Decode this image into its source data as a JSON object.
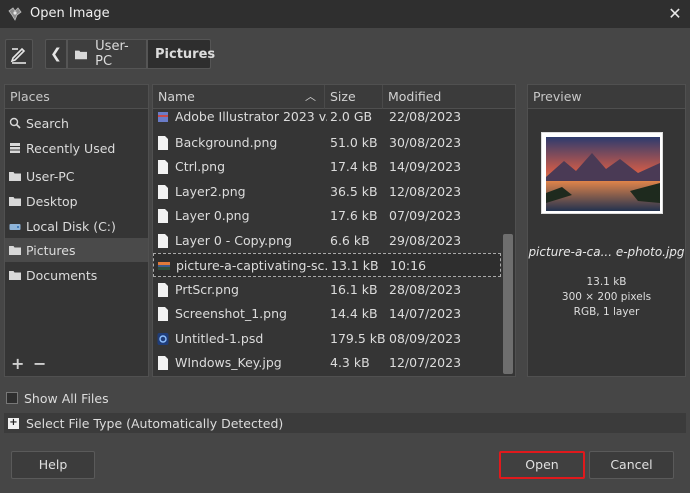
{
  "window": {
    "title": "Open Image"
  },
  "nav": {
    "back_icon": "chevron-left-icon",
    "breadcrumbs": [
      "User-PC",
      "Pictures"
    ]
  },
  "places": {
    "header": "Places",
    "items": [
      {
        "label": "Search",
        "icon": "search-icon"
      },
      {
        "label": "Recently Used",
        "icon": "recent-icon"
      },
      {
        "label": "User-PC",
        "icon": "folder-icon"
      },
      {
        "label": "Desktop",
        "icon": "folder-icon"
      },
      {
        "label": "Local Disk (C:)",
        "icon": "drive-icon"
      },
      {
        "label": "Pictures",
        "icon": "folder-icon",
        "selected": true
      },
      {
        "label": "Documents",
        "icon": "folder-icon"
      }
    ],
    "add_label": "+",
    "remove_label": "−"
  },
  "files": {
    "columns": {
      "name": "Name",
      "size": "Size",
      "modified": "Modified"
    },
    "rows": [
      {
        "name": "Adobe Illustrator 2023 v...",
        "size": "2.0 GB",
        "modified": "22/08/2023",
        "icon": "archive-icon"
      },
      {
        "name": "Background.png",
        "size": "51.0 kB",
        "modified": "30/08/2023",
        "icon": "file-icon"
      },
      {
        "name": "Ctrl.png",
        "size": "17.4 kB",
        "modified": "14/09/2023",
        "icon": "file-icon"
      },
      {
        "name": "Layer2.png",
        "size": "36.5 kB",
        "modified": "12/08/2023",
        "icon": "file-icon"
      },
      {
        "name": "Layer 0.png",
        "size": "17.6 kB",
        "modified": "07/09/2023",
        "icon": "file-icon"
      },
      {
        "name": "Layer 0 - Copy.png",
        "size": "6.6 kB",
        "modified": "29/08/2023",
        "icon": "file-icon"
      },
      {
        "name": "picture-a-captivating-sc...",
        "size": "13.1 kB",
        "modified": "10:16",
        "icon": "image-thumb-icon",
        "selected": true
      },
      {
        "name": "PrtScr.png",
        "size": "16.1 kB",
        "modified": "28/08/2023",
        "icon": "file-icon"
      },
      {
        "name": "Screenshot_1.png",
        "size": "14.4 kB",
        "modified": "14/07/2023",
        "icon": "file-icon"
      },
      {
        "name": "Untitled-1.psd",
        "size": "179.5 kB",
        "modified": "08/09/2023",
        "icon": "psd-icon"
      },
      {
        "name": "WIndows_Key.jpg",
        "size": "4.3 kB",
        "modified": "12/07/2023",
        "icon": "file-icon"
      }
    ]
  },
  "preview": {
    "header": "Preview",
    "filename": "picture-a-ca... e-photo.jpg",
    "size": "13.1 kB",
    "dimensions": "300 × 200 pixels",
    "mode": "RGB, 1 layer"
  },
  "show_all_files": "Show All Files",
  "file_type": "Select File Type (Automatically Detected)",
  "buttons": {
    "help": "Help",
    "open": "Open",
    "cancel": "Cancel"
  },
  "colors": {
    "highlight": "#e0191c",
    "background": "#464646"
  }
}
